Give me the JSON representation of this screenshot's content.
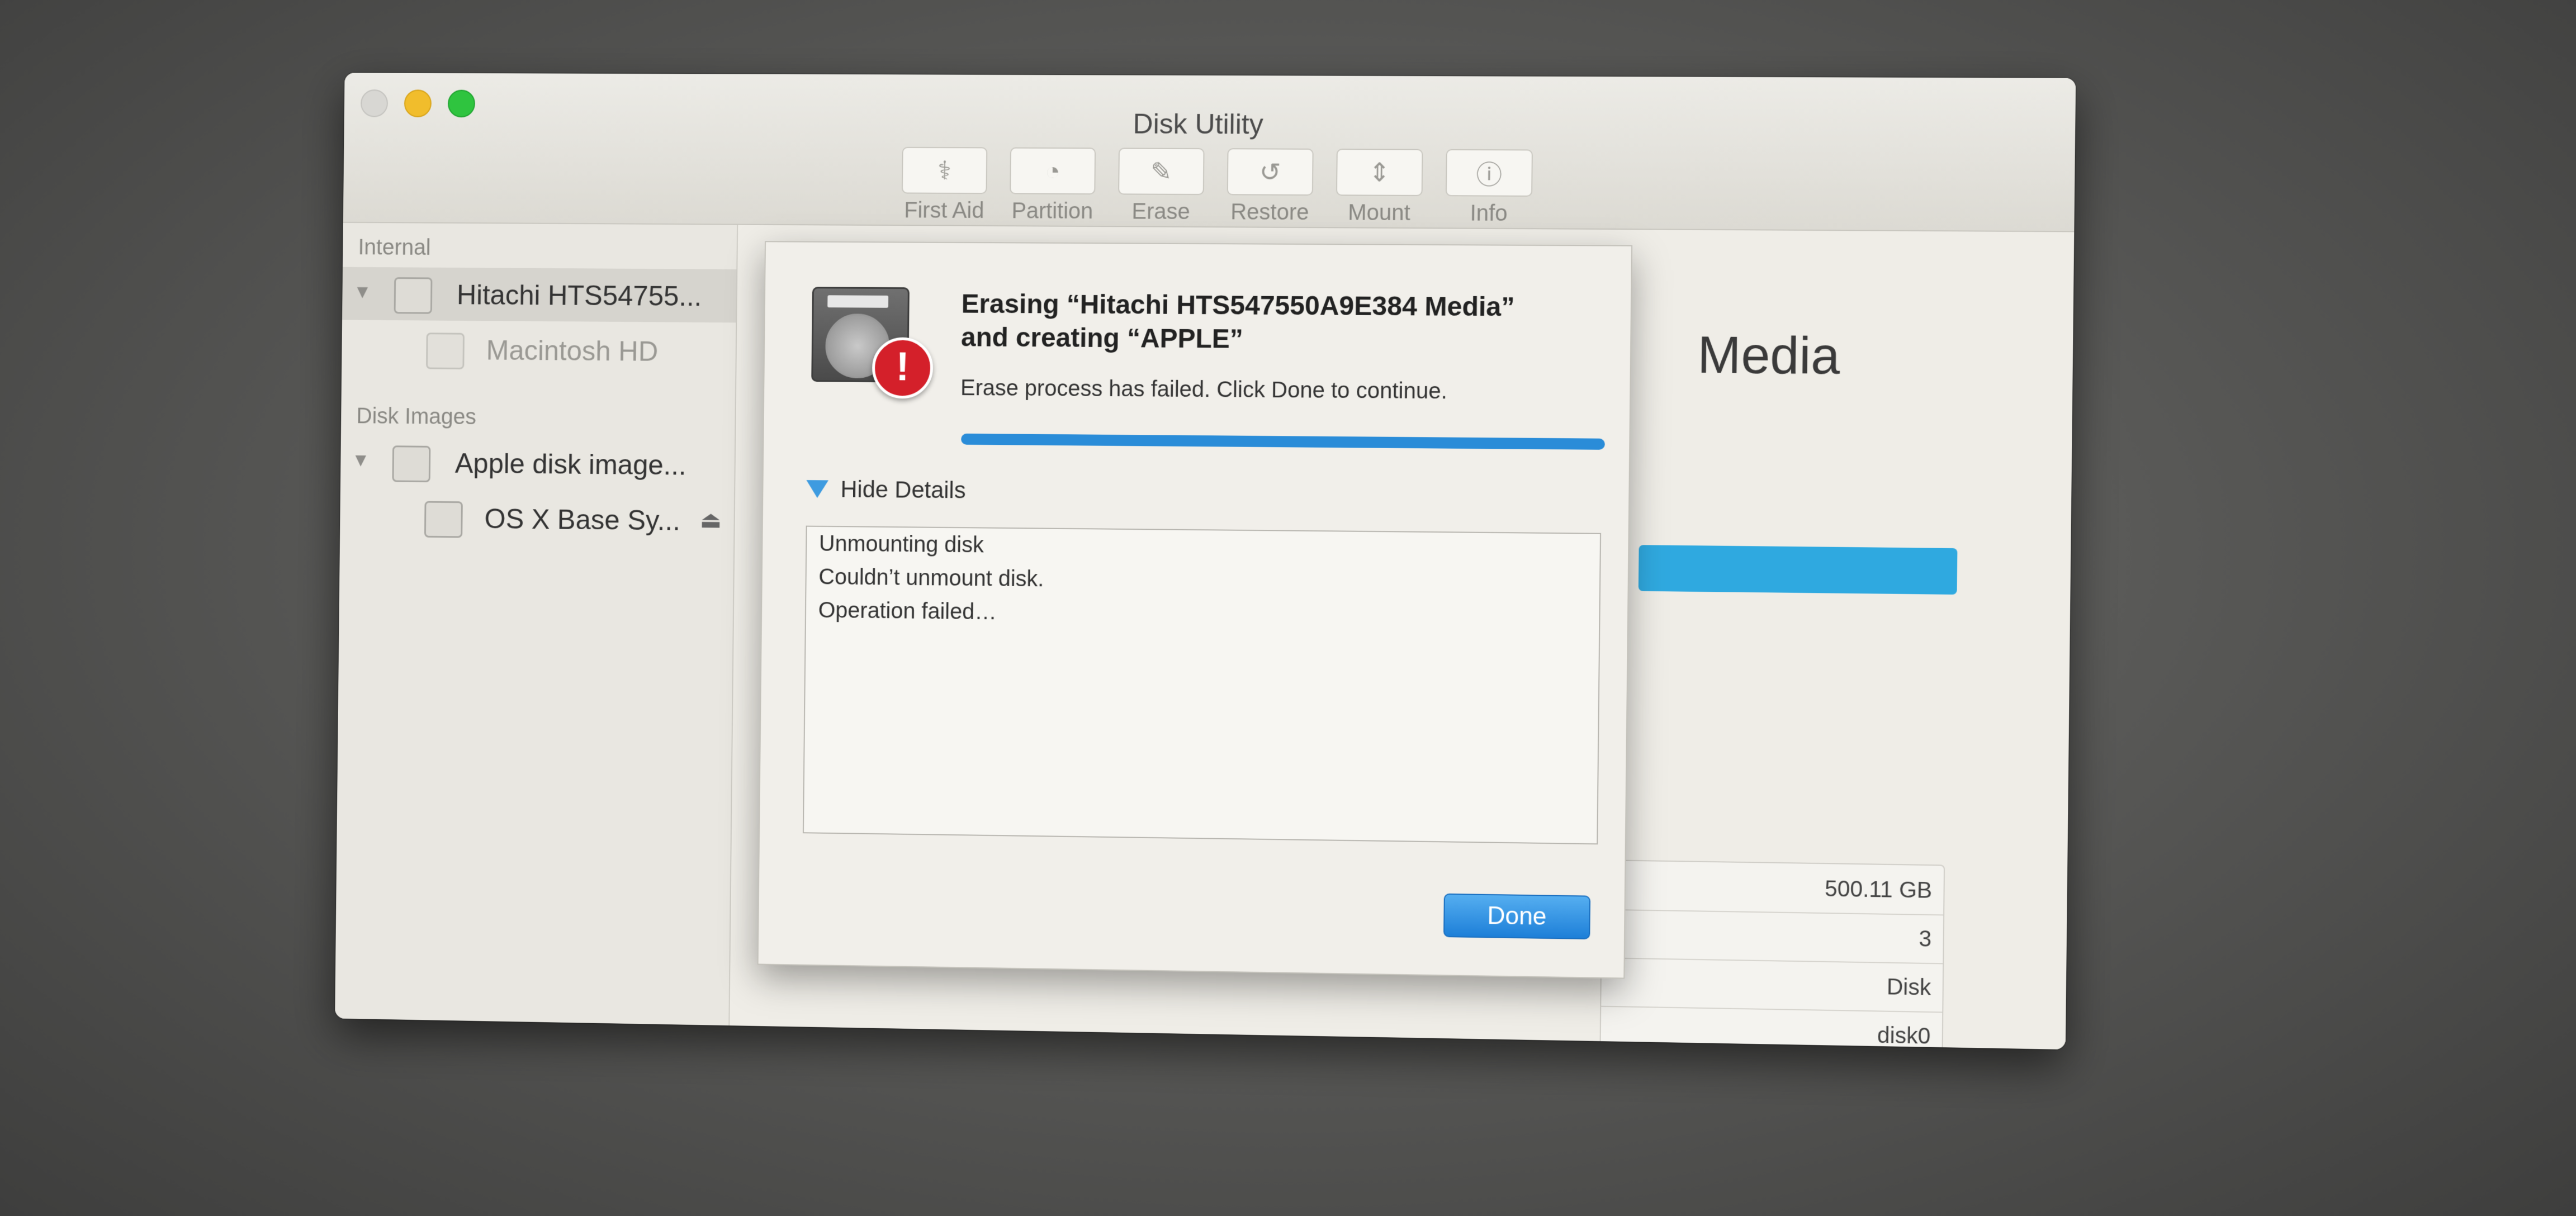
{
  "window": {
    "title": "Disk Utility"
  },
  "toolbar": {
    "items": [
      {
        "label": "First Aid",
        "glyph": "⚕"
      },
      {
        "label": "Partition",
        "glyph": "◔"
      },
      {
        "label": "Erase",
        "glyph": "✎"
      },
      {
        "label": "Restore",
        "glyph": "↺"
      },
      {
        "label": "Mount",
        "glyph": "⇕"
      },
      {
        "label": "Info",
        "glyph": "ⓘ"
      }
    ]
  },
  "sidebar": {
    "internal_header": "Internal",
    "disk_images_header": "Disk Images",
    "items": [
      {
        "label": "Hitachi HTS54755..."
      },
      {
        "label": "Macintosh HD"
      },
      {
        "label": "Apple disk image..."
      },
      {
        "label": "OS X Base Sy..."
      }
    ],
    "eject_glyph": "⏏"
  },
  "background": {
    "media_text": "Media",
    "capacity": "500.11 GB",
    "child_count": "3",
    "type": "Disk",
    "device": "disk0"
  },
  "sheet": {
    "title_line1": "Erasing “Hitachi HTS547550A9E384 Media”",
    "title_line2": "and creating “APPLE”",
    "status": "Erase process has failed. Click Done to continue.",
    "progress": 1.0,
    "details_toggle": "Hide Details",
    "log": [
      "Unmounting disk",
      "Couldn’t unmount disk.",
      "Operation failed…"
    ],
    "warning_glyph": "!",
    "done_label": "Done"
  },
  "colors": {
    "accent": "#2a8cd8",
    "warning": "#d4202a",
    "close": "#d8d7d3",
    "minimize": "#f1bd2c",
    "zoom": "#2fc43f"
  }
}
